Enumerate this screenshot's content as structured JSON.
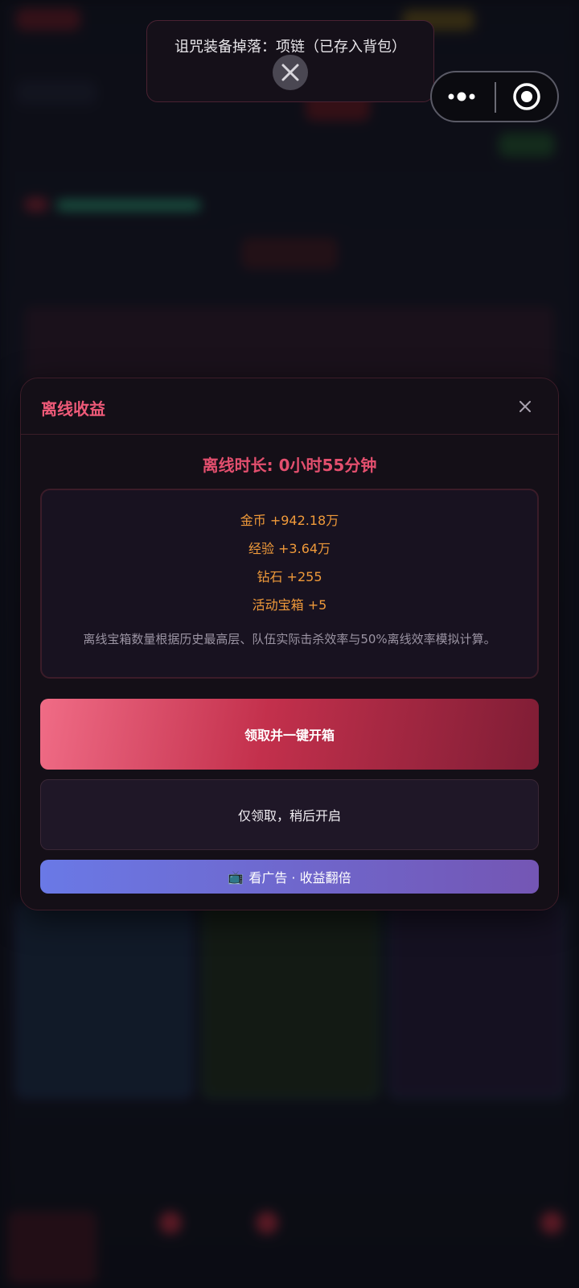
{
  "toast": {
    "text": "诅咒装备掉落：项链（已存入背包）"
  },
  "capsule": {
    "more_icon": "more-dots-icon",
    "close_icon": "target-close-icon"
  },
  "offline_modal": {
    "title": "离线收益",
    "duration": "离线时长: 0小时55分钟",
    "rewards": [
      "金币 +942.18万",
      "经验 +3.64万",
      "钻石 +255",
      "活动宝箱 +5"
    ],
    "note": "离线宝箱数量根据历史最高层、队伍实际击杀效率与50%离线效率模拟计算。",
    "buttons": {
      "claim_and_open": "领取并一键开箱",
      "claim_only": "仅领取，稍后开启",
      "ad_double_icon": "📺",
      "ad_double": "看广告 · 收益翻倍"
    }
  },
  "colors": {
    "accent": "#ee5a78",
    "reward_text": "#f09a3a",
    "modal_bg": "#140f17",
    "ad_gradient_start": "#6a79e6",
    "ad_gradient_end": "#7456b4"
  }
}
